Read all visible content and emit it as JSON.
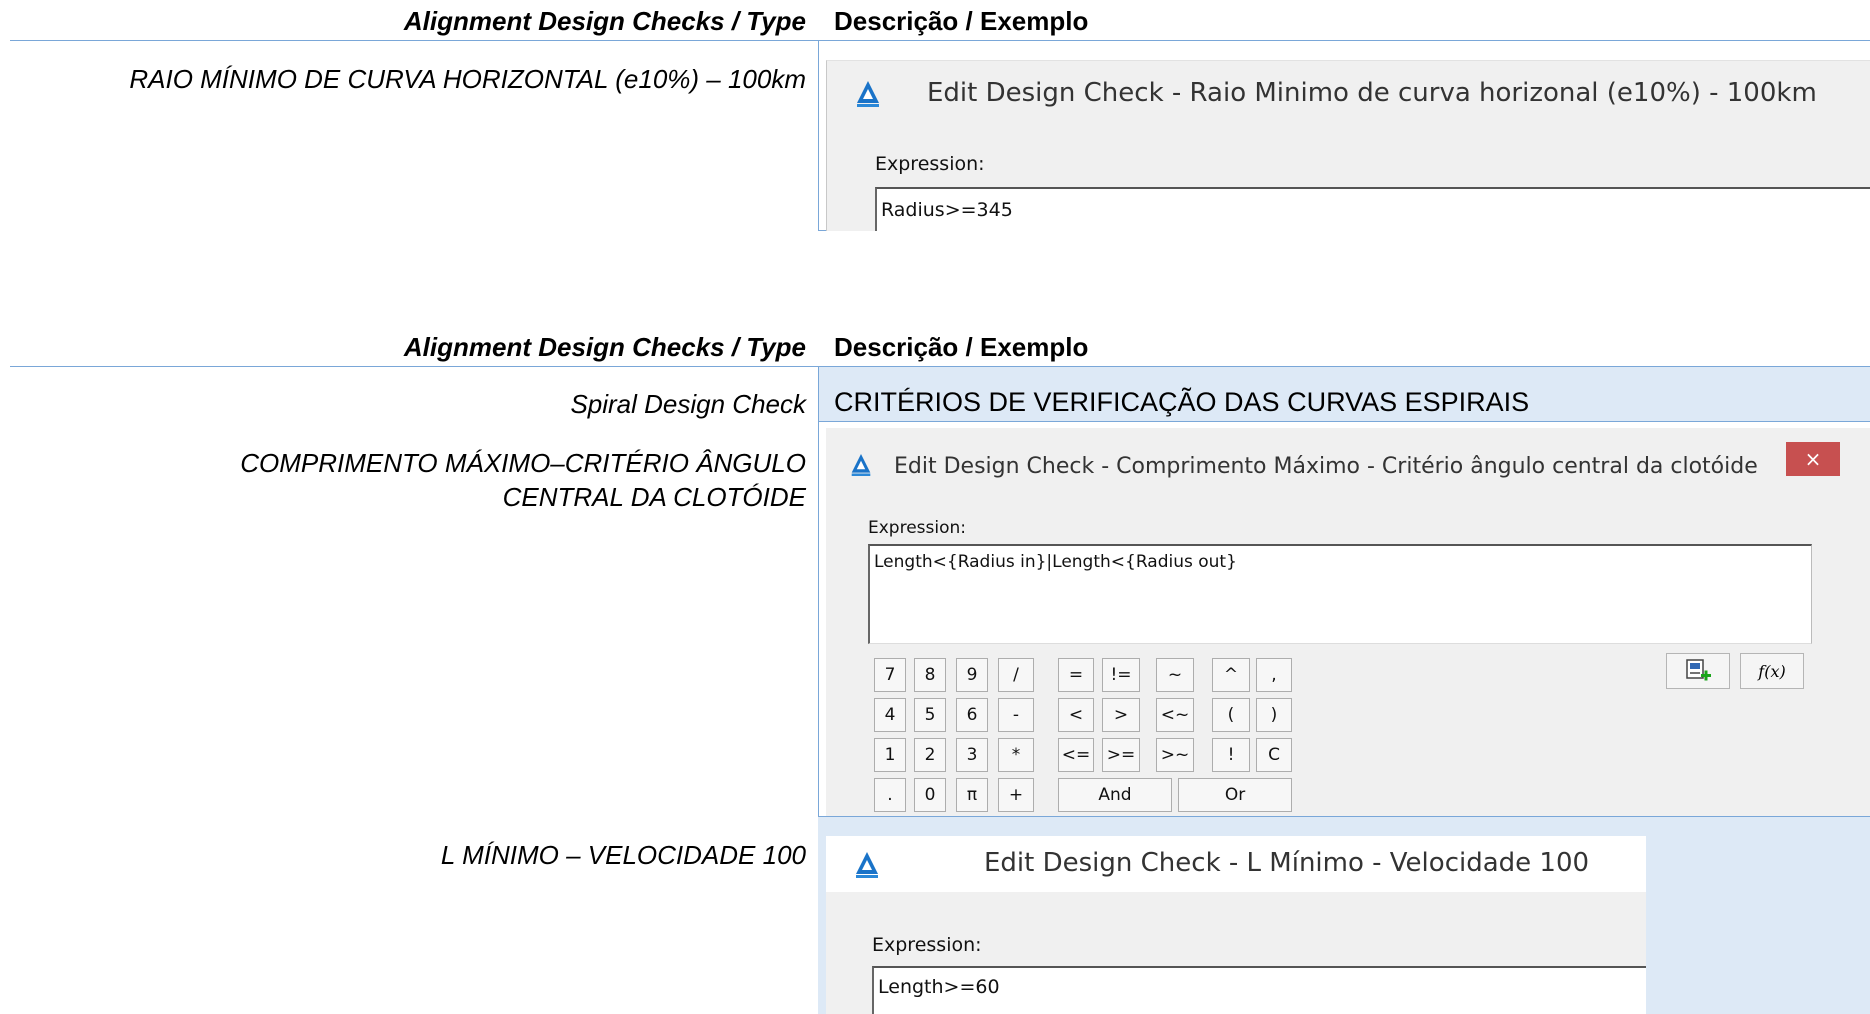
{
  "section1": {
    "header_left": "Alignment Design Checks / Type",
    "header_right": "Descrição / Exemplo",
    "row_label": "RAIO MÍNIMO DE CURVA HORIZONTAL (e10%) – 100km",
    "dialog": {
      "title": "Edit Design Check - Raio Minimo de curva horizonal (e10%) - 100km",
      "expression_label": "Expression:",
      "expression_value": "Radius>=345",
      "app_icon": "civil3d-app-icon"
    }
  },
  "section2": {
    "header_left": "Alignment Design Checks / Type",
    "header_right": "Descrição / Exemplo",
    "type_label": "Spiral Design Check",
    "type_description": "CRITÉRIOS DE VERIFICAÇÃO DAS CURVAS ESPIRAIS",
    "row1_label_line1": "COMPRIMENTO MÁXIMO–CRITÉRIO ÂNGULO",
    "row1_label_line2": "CENTRAL DA CLOTÓIDE",
    "dialog1": {
      "title": "Edit Design Check - Comprimento Máximo - Critério ângulo central da clotóide",
      "close": "×",
      "expression_label": "Expression:",
      "expression_value": "Length<{Radius in}|Length<{Radius out}",
      "keypad": {
        "r1": [
          "7",
          "8",
          "9",
          "/",
          "=",
          "!=",
          "~",
          "^",
          ","
        ],
        "r2": [
          "4",
          "5",
          "6",
          "-",
          "<",
          ">",
          "<~",
          "(",
          ")"
        ],
        "r3": [
          "1",
          "2",
          "3",
          "*",
          "<=",
          ">=",
          ">~",
          "!",
          "C"
        ],
        "r4": [
          ".",
          "0",
          "π",
          "+",
          "And",
          "Or"
        ]
      },
      "insert_property_icon": "insert-property-icon",
      "insert_function_label": "f(x)"
    },
    "row2_label": "L MÍNIMO – VELOCIDADE 100",
    "dialog2": {
      "title": "Edit Design Check - L Mínimo - Velocidade 100",
      "expression_label": "Expression:",
      "expression_value": "Length>=60"
    }
  }
}
